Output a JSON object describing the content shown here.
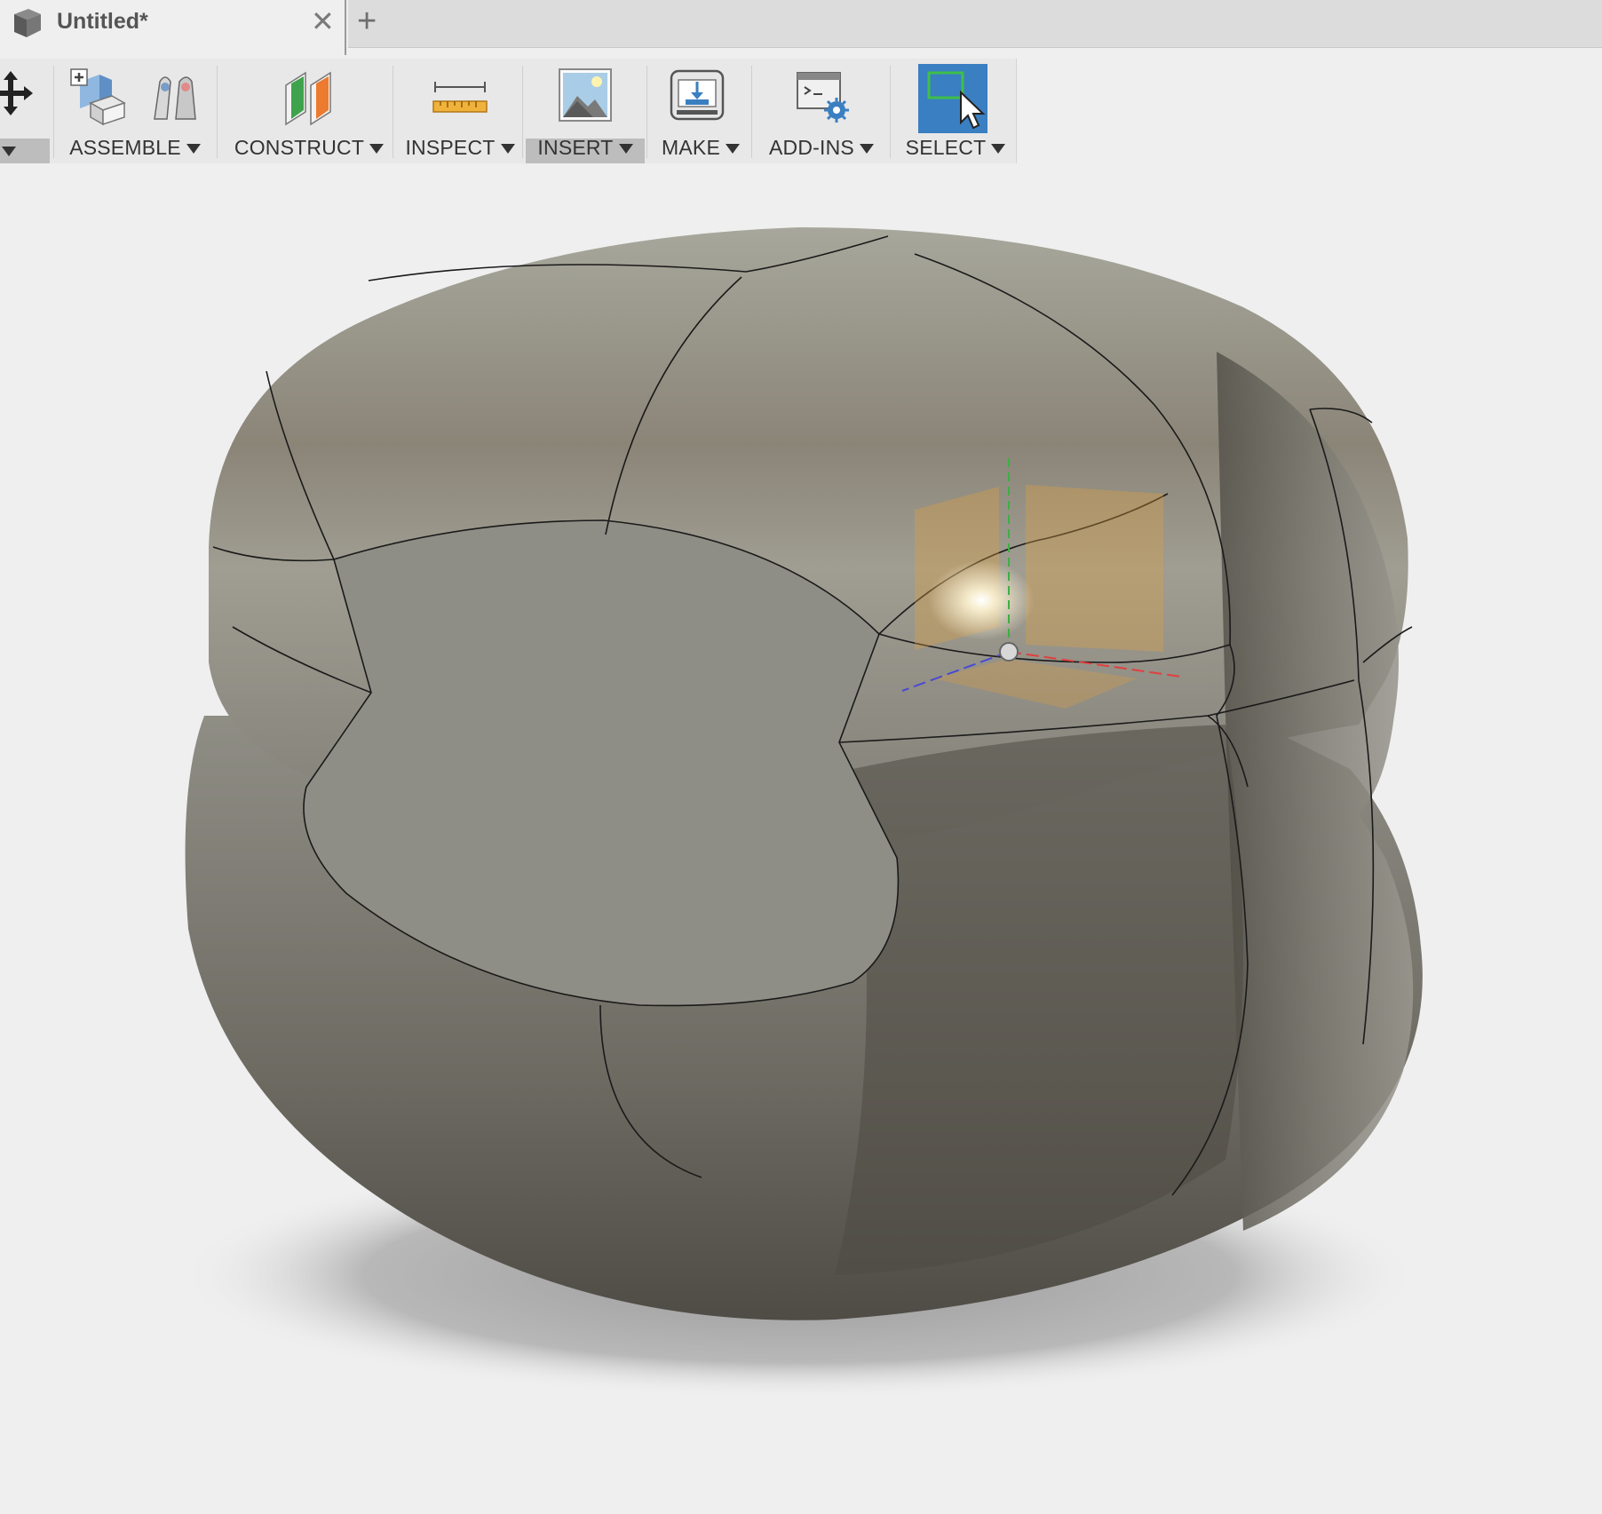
{
  "tab": {
    "title": "Untitled*",
    "close_glyph": "✕",
    "new_tab_glyph": "+",
    "icon": "document-cube-icon"
  },
  "toolbar": {
    "groups": [
      {
        "label": "",
        "icon": "move-icon"
      },
      {
        "label": "ASSEMBLE",
        "icon": "new-component-icon"
      },
      {
        "label": "CONSTRUCT",
        "icon": "construct-plane-icon"
      },
      {
        "label": "INSPECT",
        "icon": "measure-ruler-icon"
      },
      {
        "label": "INSERT",
        "icon": "insert-image-icon",
        "active": true
      },
      {
        "label": "MAKE",
        "icon": "3d-print-icon"
      },
      {
        "label": "ADD-INS",
        "icon": "scripts-addins-icon"
      },
      {
        "label": "SELECT",
        "icon": "select-window-icon",
        "active": true
      }
    ]
  },
  "viewport": {
    "model": "t-spline-body",
    "manipulator": "move-gizmo"
  },
  "colors": {
    "select_active": "#3a7fc1",
    "gizmo_orange": "#e0a040",
    "axis_x": "#e04040",
    "axis_y": "#3cb043",
    "axis_z": "#4a4ad0"
  }
}
